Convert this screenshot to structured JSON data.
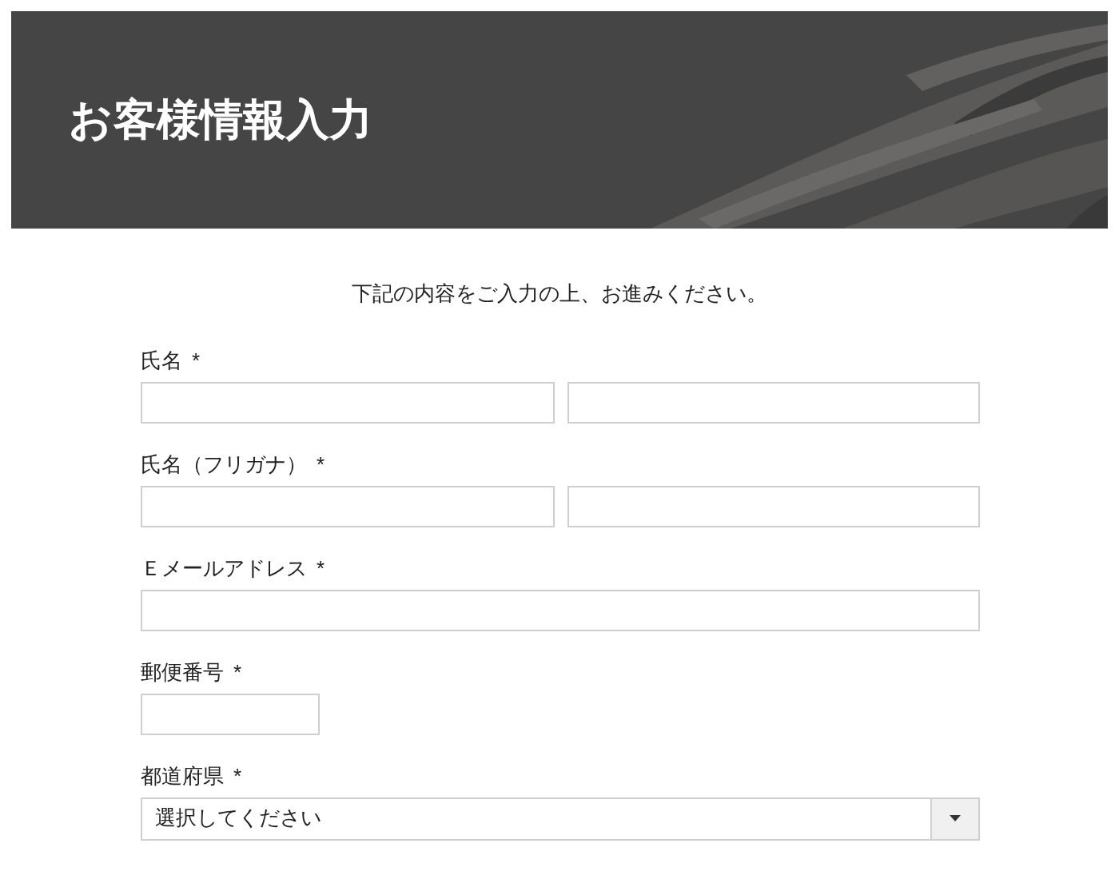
{
  "header": {
    "title": "お客様情報入力"
  },
  "intro": "下記の内容をご入力の上、お進みください。",
  "fields": [
    {
      "kind": "pair",
      "label": "氏名",
      "required_mark": "*"
    },
    {
      "kind": "pair",
      "label": "氏名（フリガナ）",
      "required_mark": "*"
    },
    {
      "kind": "single",
      "label": "Ｅメールアドレス",
      "required_mark": "*"
    },
    {
      "kind": "short",
      "label": "郵便番号",
      "required_mark": "*"
    },
    {
      "kind": "select",
      "label": "都道府県",
      "required_mark": "*",
      "value": "選択してください"
    }
  ]
}
